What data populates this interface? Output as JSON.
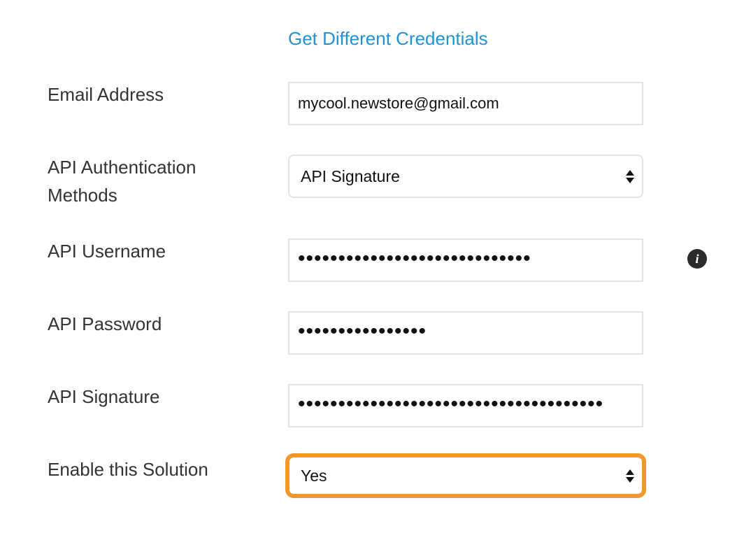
{
  "credentials_link": "Get Different Credentials",
  "fields": {
    "email": {
      "label": "Email Address",
      "value": "mycool.newstore@gmail.com"
    },
    "auth_method": {
      "label": "API Authentication Methods",
      "selected": "API Signature"
    },
    "username": {
      "label": "API Username",
      "masked_value": "•••••••••••••••••••••••••••••"
    },
    "password": {
      "label": "API Password",
      "masked_value": "••••••••••••••••"
    },
    "signature": {
      "label": "API Signature",
      "masked_value": "••••••••••••••••••••••••••••••••••••••"
    },
    "enable": {
      "label": "Enable this Solution",
      "selected": "Yes"
    }
  },
  "info_icon_glyph": "i",
  "colors": {
    "link": "#1f93d1",
    "focus_outline": "#f0962b",
    "label_text": "#333333"
  }
}
